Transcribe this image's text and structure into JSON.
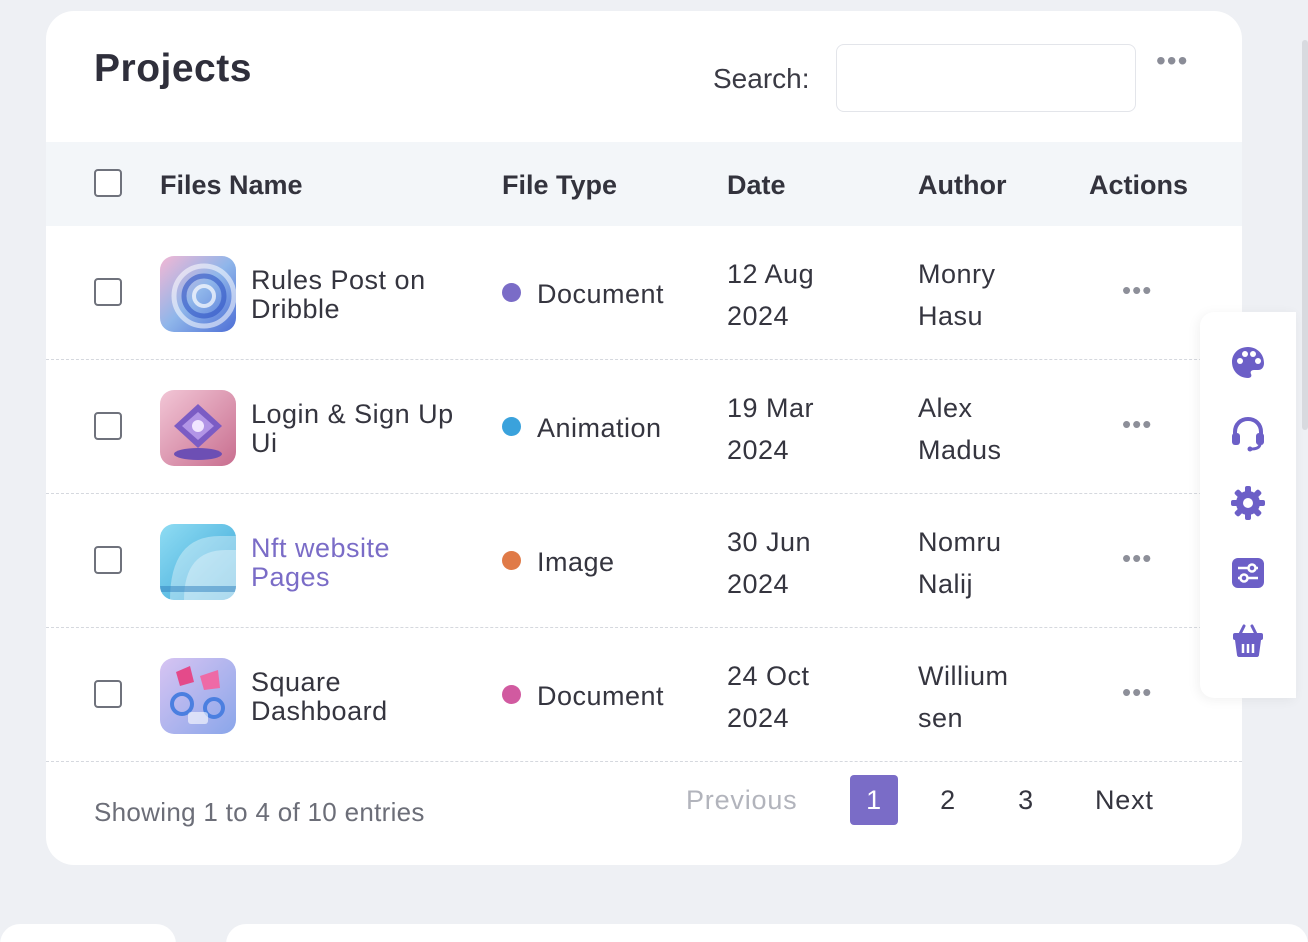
{
  "header": {
    "title": "Projects",
    "search_label": "Search:",
    "search_value": "",
    "menu_icon": "more-horizontal-icon"
  },
  "table": {
    "columns": [
      "Files Name",
      "File Type",
      "Date",
      "Author",
      "Actions"
    ],
    "rows": [
      {
        "name": "Rules Post on Dribble",
        "type": "Document",
        "type_color": "#7a6cc7",
        "date_day": "12 Aug",
        "date_year": "2024",
        "author_first": "Monry",
        "author_last": "Hasu",
        "highlight": false
      },
      {
        "name": "Login & Sign Up Ui",
        "type": "Animation",
        "type_color": "#3aa2dc",
        "date_day": "19 Mar",
        "date_year": "2024",
        "author_first": "Alex",
        "author_last": "Madus",
        "highlight": false
      },
      {
        "name": "Nft website Pages",
        "type": "Image",
        "type_color": "#e07a47",
        "date_day": "30 Jun",
        "date_year": "2024",
        "author_first": "Nomru",
        "author_last": "Nalij",
        "highlight": true
      },
      {
        "name": "Square Dashboard",
        "type": "Document",
        "type_color": "#d15aa0",
        "date_day": "24 Oct",
        "date_year": "2024",
        "author_first": "Willium",
        "author_last": "sen",
        "highlight": false
      }
    ]
  },
  "footer": {
    "showing": "Showing 1 to 4 of 10 entries",
    "previous": "Previous",
    "pages": [
      "1",
      "2",
      "3"
    ],
    "current_page": "1",
    "next": "Next"
  },
  "side_panel": {
    "icons": [
      "palette-icon",
      "headset-icon",
      "gear-icon",
      "sliders-icon",
      "basket-icon"
    ],
    "accent": "#6c5fc7"
  }
}
